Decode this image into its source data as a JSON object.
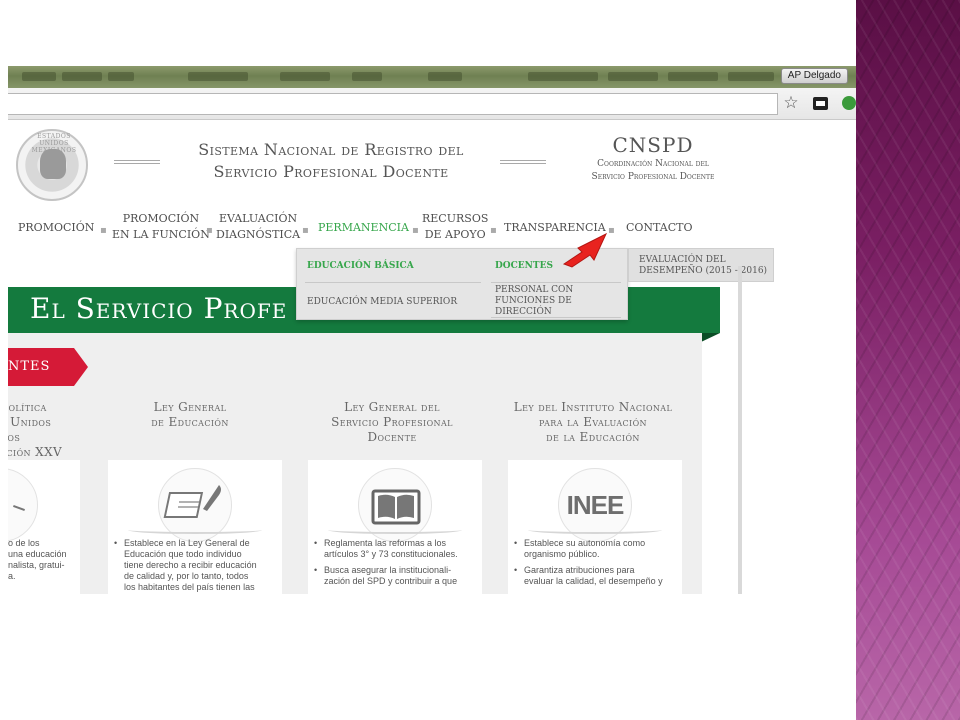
{
  "browser": {
    "user_badge": "AP Delgado",
    "icons": [
      "star-icon",
      "extension-icon",
      "green-extension-icon"
    ]
  },
  "header": {
    "seal_text": "ESTADOS UNIDOS MEXICANOS",
    "title_line1": "Sistema Nacional de Registro del",
    "title_line2": "Servicio Profesional Docente",
    "org": "CNSPD",
    "org_sub1": "Coordinación Nacional del",
    "org_sub2": "Servicio Profesional Docente"
  },
  "nav": {
    "items": [
      {
        "l1": "PROMOCIÓN",
        "l2": ""
      },
      {
        "l1": "PROMOCIÓN",
        "l2": "EN LA FUNCIÓN"
      },
      {
        "l1": "EVALUACIÓN",
        "l2": "DIAGNÓSTICA"
      },
      {
        "l1": "PERMANENCIA",
        "l2": ""
      },
      {
        "l1": "RECURSOS",
        "l2": "DE APOYO"
      },
      {
        "l1": "TRANSPARENCIA",
        "l2": ""
      },
      {
        "l1": "CONTACTO",
        "l2": ""
      }
    ],
    "active_color": "#36a64b"
  },
  "dropdown": {
    "col1": [
      "EDUCACIÓN BÁSICA",
      "EDUCACIÓN MEDIA SUPERIOR"
    ],
    "col2": [
      "DOCENTES",
      "PERSONAL CON",
      "FUNCIONES DE",
      "DIRECCIÓN"
    ],
    "col3_l1": "EVALUACIÓN DEL",
    "col3_l2": "DESEMPEÑO (2015 - 2016)"
  },
  "hero": {
    "title": "El Servicio Profe",
    "color": "#147a3e"
  },
  "red_tab": {
    "label": "ntes",
    "color": "#d51a37"
  },
  "columns": [
    {
      "title_lines": [
        "Política",
        "s Unidos",
        "nos",
        "cción XXV"
      ],
      "bullets": [
        "o de los",
        "una educación",
        "nalista, gratui-",
        "a."
      ]
    },
    {
      "title_lines": [
        "Ley General",
        "de Educación"
      ],
      "bullets": [
        "Establece en la Ley General de",
        "Educación que todo individuo",
        "tiene derecho a recibir educación",
        "de calidad y, por lo tanto, todos",
        "los habitantes del país tienen las"
      ]
    },
    {
      "title_lines": [
        "Ley General del",
        "Servicio Profesional",
        "Docente"
      ],
      "bullets": [
        "Reglamenta las reformas a los",
        "artículos 3° y 73 constitucionales.",
        "Busca asegurar la institucionali-",
        "zación del SPD y contribuir a que"
      ]
    },
    {
      "title_lines": [
        "Ley del Instituto Nacional",
        "para la Evaluación",
        "de la Educación"
      ],
      "logo": "INEE",
      "bullets": [
        "Establece su autonomía como",
        "organismo público.",
        "Garantiza atribuciones para",
        "evaluar la calidad, el desempeño y"
      ]
    }
  ]
}
